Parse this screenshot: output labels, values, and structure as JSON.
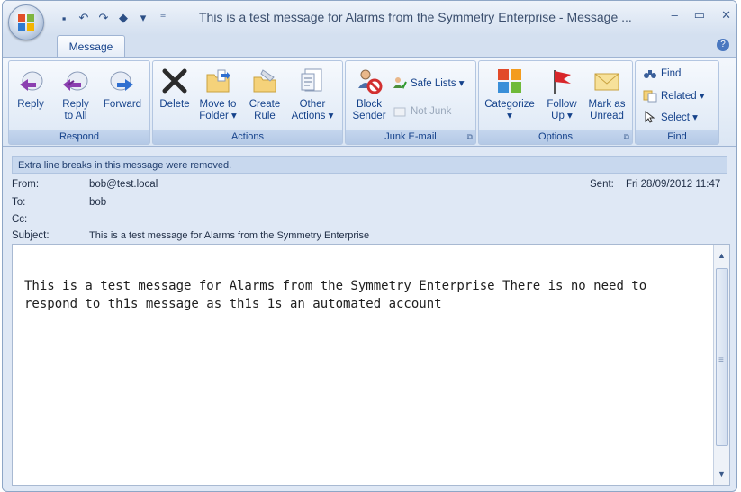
{
  "window": {
    "title": "This is a test message for Alarms from the Symmetry Enterprise - Message ...",
    "controls": [
      "–",
      "▭",
      "✕"
    ]
  },
  "quick_access": [
    "save-icon",
    "undo-icon",
    "redo-icon",
    "up-icon",
    "down-icon",
    "customize-icon"
  ],
  "tabs": [
    {
      "label": "Message"
    }
  ],
  "ribbon": {
    "respond": {
      "label": "Respond",
      "reply": "Reply",
      "reply_all_1": "Reply",
      "reply_all_2": "to All",
      "forward": "Forward"
    },
    "actions": {
      "label": "Actions",
      "delete": "Delete",
      "move_1": "Move to",
      "move_2": "Folder ▾",
      "create_1": "Create",
      "create_2": "Rule",
      "other_1": "Other",
      "other_2": "Actions ▾"
    },
    "junk": {
      "label": "Junk E-mail",
      "block_1": "Block",
      "block_2": "Sender",
      "safe_lists": "Safe Lists ▾",
      "not_junk": "Not Junk"
    },
    "options": {
      "label": "Options",
      "categorize_1": "Categorize",
      "categorize_2": "▾",
      "follow_1": "Follow",
      "follow_2": "Up ▾",
      "mark_1": "Mark as",
      "mark_2": "Unread"
    },
    "find": {
      "label": "Find",
      "find": "Find",
      "related": "Related ▾",
      "select": "Select ▾"
    }
  },
  "infobar": "Extra line breaks in this message were removed.",
  "header": {
    "from_label": "From:",
    "from": "bob@test.local",
    "sent_label": "Sent:",
    "sent": "Fri 28/09/2012 11:47",
    "to_label": "To:",
    "to": "bob",
    "cc_label": "Cc:",
    "cc": "",
    "subject_label": "Subject:",
    "subject": "This is a test message for Alarms from the Symmetry Enterprise"
  },
  "body": {
    "line1": "This is a test message for Alarms from the Symmetry Enterprise There is no need to",
    "line2": "respond to th1s message as th1s 1s an automated account"
  },
  "colors": {
    "ribbon_text": "#15428b",
    "frame": "#dfe8f5",
    "info_bar": "#c8d8ee"
  }
}
